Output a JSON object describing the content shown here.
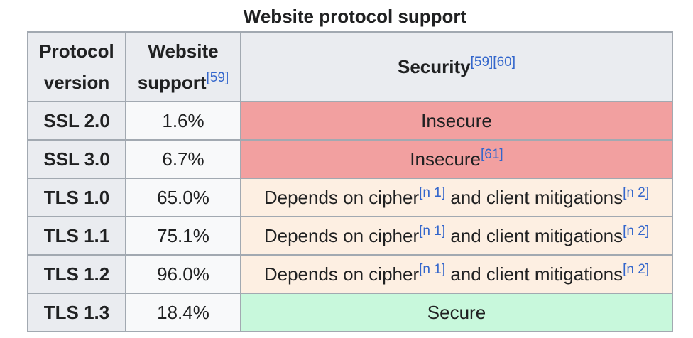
{
  "caption": "Website protocol support",
  "headers": {
    "version_line1": "Protocol",
    "version_line2": "version",
    "support_line1": "Website",
    "support_line2": "support",
    "support_ref": "[59]",
    "security": "Security",
    "security_ref1": "[59]",
    "security_ref2": "[60]"
  },
  "rows": [
    {
      "version": "SSL 2.0",
      "support": "1.6%",
      "security": "Insecure",
      "status": "insecure"
    },
    {
      "version": "SSL 3.0",
      "support": "6.7%",
      "security": "Insecure",
      "ref": "[61]",
      "status": "insecure"
    },
    {
      "version": "TLS 1.0",
      "support": "65.0%",
      "security_a": "Depends on cipher",
      "ref_a": "[n 1]",
      "security_b": " and client mitigations",
      "ref_b": "[n 2]",
      "status": "depends"
    },
    {
      "version": "TLS 1.1",
      "support": "75.1%",
      "security_a": "Depends on cipher",
      "ref_a": "[n 1]",
      "security_b": " and client mitigations",
      "ref_b": "[n 2]",
      "status": "depends"
    },
    {
      "version": "TLS 1.2",
      "support": "96.0%",
      "security_a": "Depends on cipher",
      "ref_a": "[n 1]",
      "security_b": " and client mitigations",
      "ref_b": "[n 2]",
      "status": "depends"
    },
    {
      "version": "TLS 1.3",
      "support": "18.4%",
      "security": "Secure",
      "status": "secure"
    }
  ],
  "colors": {
    "insecure": "#f2a0a0",
    "depends": "#fdefe2",
    "secure": "#c8f8dc",
    "header": "#eaecf0",
    "border": "#a2a9b1",
    "link": "#3366cc"
  }
}
